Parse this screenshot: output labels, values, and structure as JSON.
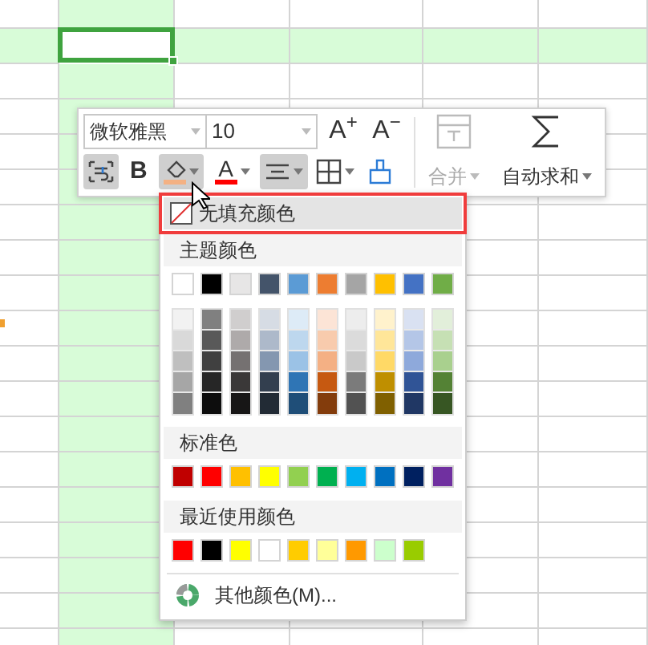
{
  "grid": {
    "rows": [
      {
        "selected": false
      },
      {
        "selected": true
      },
      {
        "selected": false
      },
      {
        "selected": false
      },
      {
        "selected": false
      },
      {
        "selected": false
      },
      {
        "selected": false
      },
      {
        "selected": false
      },
      {
        "selected": false
      },
      {
        "selected": false
      },
      {
        "selected": false
      },
      {
        "selected": false
      },
      {
        "selected": false
      },
      {
        "selected": false
      },
      {
        "selected": false
      },
      {
        "selected": false
      },
      {
        "selected": false
      },
      {
        "selected": false
      },
      {
        "selected": false
      }
    ],
    "columns": [
      {
        "selected": false
      },
      {
        "selected": true
      },
      {
        "selected": false
      },
      {
        "selected": false
      },
      {
        "selected": false
      },
      {
        "selected": false
      }
    ]
  },
  "toolbar": {
    "font": {
      "value": "微软雅黑"
    },
    "size": {
      "value": "10"
    },
    "size_buttons": [
      {
        "label": "A$^{+}$"
      },
      {
        "label": "A$^{−}$"
      }
    ],
    "format_buttons": [
      {
        "kind": "wrap",
        "pressed": true
      },
      {
        "kind": "bold",
        "label": "B",
        "pressed": false
      },
      {
        "kind": "fill",
        "pressed": true,
        "color": "#f4b183"
      },
      {
        "kind": "font-color",
        "label": "A",
        "pressed": false,
        "color": "#ff0000"
      },
      {
        "kind": "align",
        "pressed": true
      },
      {
        "kind": "border",
        "pressed": false
      },
      {
        "kind": "brush",
        "pressed": false
      }
    ],
    "merge": {
      "label": "合并",
      "disabled": true
    },
    "autosum": {
      "label": "自动求和",
      "disabled": false
    }
  },
  "menu": {
    "no_fill": {
      "label": "无填充颜色",
      "highlighted": true
    },
    "sections": [
      {
        "kind": "theme",
        "title": "主题颜色",
        "base": [
          {
            "color": "#ffffff"
          },
          {
            "color": "#000000"
          },
          {
            "color": "#e7e6e6"
          },
          {
            "color": "#44546a"
          },
          {
            "color": "#5b9bd5"
          },
          {
            "color": "#ed7d31"
          },
          {
            "color": "#a5a5a5"
          },
          {
            "color": "#ffc000"
          },
          {
            "color": "#4472c4"
          },
          {
            "color": "#70ad47"
          }
        ],
        "shades": [
          {
            "colors": [
              {
                "color": "#f2f2f2"
              },
              {
                "color": "#d9d9d9"
              },
              {
                "color": "#bfbfbf"
              },
              {
                "color": "#a6a6a6"
              },
              {
                "color": "#808080"
              }
            ]
          },
          {
            "colors": [
              {
                "color": "#808080"
              },
              {
                "color": "#595959"
              },
              {
                "color": "#404040"
              },
              {
                "color": "#262626"
              },
              {
                "color": "#0d0d0d"
              }
            ]
          },
          {
            "colors": [
              {
                "color": "#d0cece"
              },
              {
                "color": "#aeaaaa"
              },
              {
                "color": "#757171"
              },
              {
                "color": "#3a3838"
              },
              {
                "color": "#171616"
              }
            ]
          },
          {
            "colors": [
              {
                "color": "#d6dce4"
              },
              {
                "color": "#adb9ca"
              },
              {
                "color": "#8497b0"
              },
              {
                "color": "#333f4f"
              },
              {
                "color": "#222b35"
              }
            ]
          },
          {
            "colors": [
              {
                "color": "#ddebf7"
              },
              {
                "color": "#bdd7ee"
              },
              {
                "color": "#9bc2e6"
              },
              {
                "color": "#2f75b5"
              },
              {
                "color": "#1f4e78"
              }
            ]
          },
          {
            "colors": [
              {
                "color": "#fce4d6"
              },
              {
                "color": "#f8cbad"
              },
              {
                "color": "#f4b084"
              },
              {
                "color": "#c65911"
              },
              {
                "color": "#833c0c"
              }
            ]
          },
          {
            "colors": [
              {
                "color": "#ededed"
              },
              {
                "color": "#dbdbdb"
              },
              {
                "color": "#c9c9c9"
              },
              {
                "color": "#7b7b7b"
              },
              {
                "color": "#525252"
              }
            ]
          },
          {
            "colors": [
              {
                "color": "#fff2cc"
              },
              {
                "color": "#ffe699"
              },
              {
                "color": "#ffd966"
              },
              {
                "color": "#bf8f00"
              },
              {
                "color": "#806000"
              }
            ]
          },
          {
            "colors": [
              {
                "color": "#d9e1f2"
              },
              {
                "color": "#b4c6e7"
              },
              {
                "color": "#8ea9db"
              },
              {
                "color": "#305496"
              },
              {
                "color": "#203764"
              }
            ]
          },
          {
            "colors": [
              {
                "color": "#e2efda"
              },
              {
                "color": "#c6e0b4"
              },
              {
                "color": "#a9d08e"
              },
              {
                "color": "#548235"
              },
              {
                "color": "#375623"
              }
            ]
          }
        ]
      },
      {
        "kind": "swatches",
        "title": "标准色",
        "colors": [
          {
            "color": "#c00000"
          },
          {
            "color": "#ff0000"
          },
          {
            "color": "#ffc000"
          },
          {
            "color": "#ffff00"
          },
          {
            "color": "#92d050"
          },
          {
            "color": "#00b050"
          },
          {
            "color": "#00b0f0"
          },
          {
            "color": "#0070c0"
          },
          {
            "color": "#002060"
          },
          {
            "color": "#7030a0"
          }
        ]
      },
      {
        "kind": "swatches",
        "title": "最近使用颜色",
        "colors": [
          {
            "color": "#ff0000"
          },
          {
            "color": "#000000"
          },
          {
            "color": "#ffff00"
          },
          {
            "color": "#ffffff"
          },
          {
            "color": "#ffcc00"
          },
          {
            "color": "#ffff99"
          },
          {
            "color": "#ff9900"
          },
          {
            "color": "#ccffcc"
          },
          {
            "color": "#99cc00"
          }
        ]
      }
    ],
    "more": {
      "label": "其他颜色(M)..."
    }
  }
}
